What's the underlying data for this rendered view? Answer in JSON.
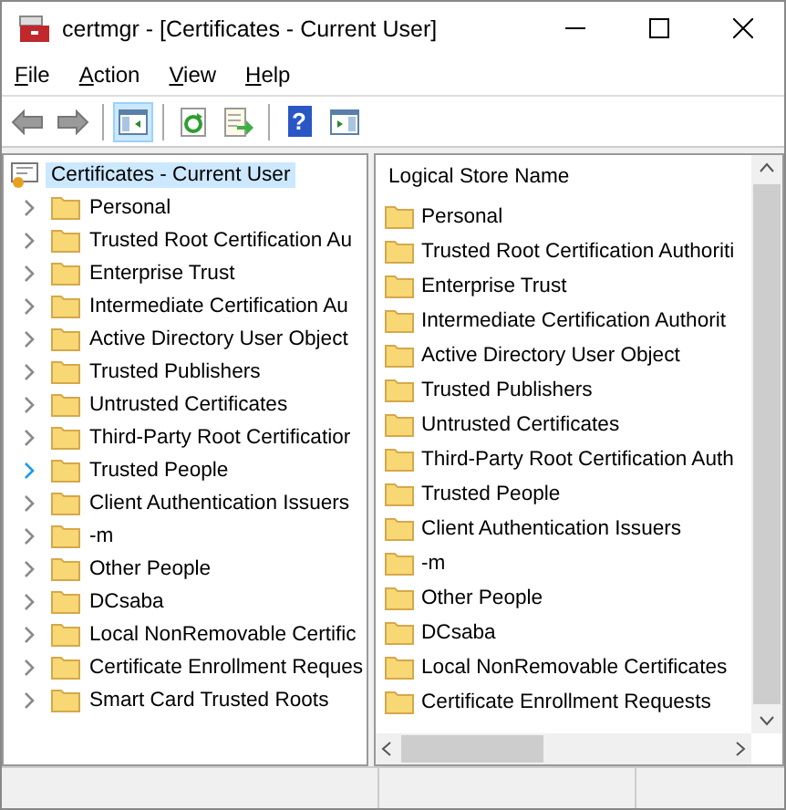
{
  "window": {
    "title": "certmgr - [Certificates - Current User]"
  },
  "menu": [
    "File",
    "Action",
    "View",
    "Help"
  ],
  "toolbar": [
    {
      "kind": "back",
      "pressed": false
    },
    {
      "kind": "forward",
      "pressed": false
    },
    {
      "kind": "sep"
    },
    {
      "kind": "tree",
      "pressed": true
    },
    {
      "kind": "sep"
    },
    {
      "kind": "refresh",
      "pressed": false
    },
    {
      "kind": "export",
      "pressed": false
    },
    {
      "kind": "sep"
    },
    {
      "kind": "help",
      "pressed": false,
      "glyph": "?"
    },
    {
      "kind": "action",
      "pressed": false
    }
  ],
  "tree": {
    "root": {
      "label": "Certificates - Current User",
      "selected": true
    },
    "children": [
      {
        "label": "Personal",
        "hovered": false
      },
      {
        "label": "Trusted Root Certification Au",
        "hovered": false
      },
      {
        "label": "Enterprise Trust",
        "hovered": false
      },
      {
        "label": "Intermediate Certification Au",
        "hovered": false
      },
      {
        "label": "Active Directory User Object",
        "hovered": false
      },
      {
        "label": "Trusted Publishers",
        "hovered": false
      },
      {
        "label": "Untrusted Certificates",
        "hovered": false
      },
      {
        "label": "Third-Party Root Certificatior",
        "hovered": false
      },
      {
        "label": "Trusted People",
        "hovered": true
      },
      {
        "label": "Client Authentication Issuers",
        "hovered": false
      },
      {
        "label": "-m",
        "hovered": false
      },
      {
        "label": "Other People",
        "hovered": false
      },
      {
        "label": "DCsaba",
        "hovered": false
      },
      {
        "label": "Local NonRemovable Certific",
        "hovered": false
      },
      {
        "label": "Certificate Enrollment Reques",
        "hovered": false
      },
      {
        "label": "Smart Card Trusted Roots",
        "hovered": false
      }
    ]
  },
  "list": {
    "column": "Logical Store Name",
    "rows": [
      "Personal",
      "Trusted Root Certification Authoriti",
      "Enterprise Trust",
      "Intermediate Certification Authorit",
      "Active Directory User Object",
      "Trusted Publishers",
      "Untrusted Certificates",
      "Third-Party Root Certification Auth",
      "Trusted People",
      "Client Authentication Issuers",
      "-m",
      "Other People",
      "DCsaba",
      "Local NonRemovable Certificates",
      "Certificate Enrollment Requests"
    ]
  }
}
